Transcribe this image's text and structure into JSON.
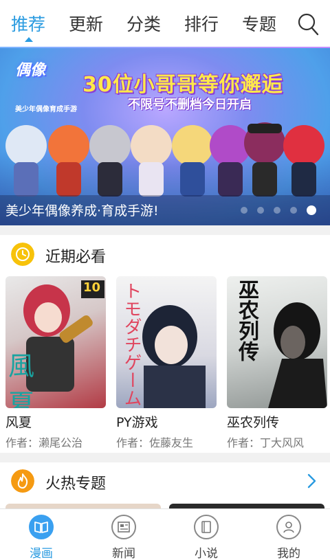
{
  "nav": {
    "tabs": [
      {
        "label": "推荐",
        "active": true
      },
      {
        "label": "更新",
        "active": false
      },
      {
        "label": "分类",
        "active": false
      },
      {
        "label": "排行",
        "active": false
      },
      {
        "label": "专题",
        "active": false
      }
    ],
    "search_icon": "search-icon"
  },
  "banner": {
    "logo_text": "偶像",
    "logo_sub": "美少年偶像育成手游",
    "headline": "30位小哥哥等你邂逅",
    "subline": "不限号不删档今日开启",
    "caption": "美少年偶像养成·育成手游!",
    "dots_total": 5,
    "active_dot": 5
  },
  "recent": {
    "title": "近期必看",
    "icon": "clock-icon",
    "accent": "#f7c20a",
    "items": [
      {
        "title": "风夏",
        "author": "作者：濑尾公治",
        "badge": "10",
        "cover_text": "風 夏"
      },
      {
        "title": "PY游戏",
        "author": "作者：佐藤友生",
        "cover_text": "トモダチゲーム"
      },
      {
        "title": "巫农列传",
        "author": "作者：丁大风风",
        "cover_text": "巫农列传"
      }
    ]
  },
  "hot": {
    "title": "火热专题",
    "icon": "flame-icon",
    "accent": "#f59a12"
  },
  "bottom_nav": [
    {
      "label": "漫画",
      "icon": "comic-book-icon",
      "active": true
    },
    {
      "label": "新闻",
      "icon": "news-icon",
      "active": false
    },
    {
      "label": "小说",
      "icon": "novel-icon",
      "active": false
    },
    {
      "label": "我的",
      "icon": "profile-icon",
      "active": false
    }
  ]
}
